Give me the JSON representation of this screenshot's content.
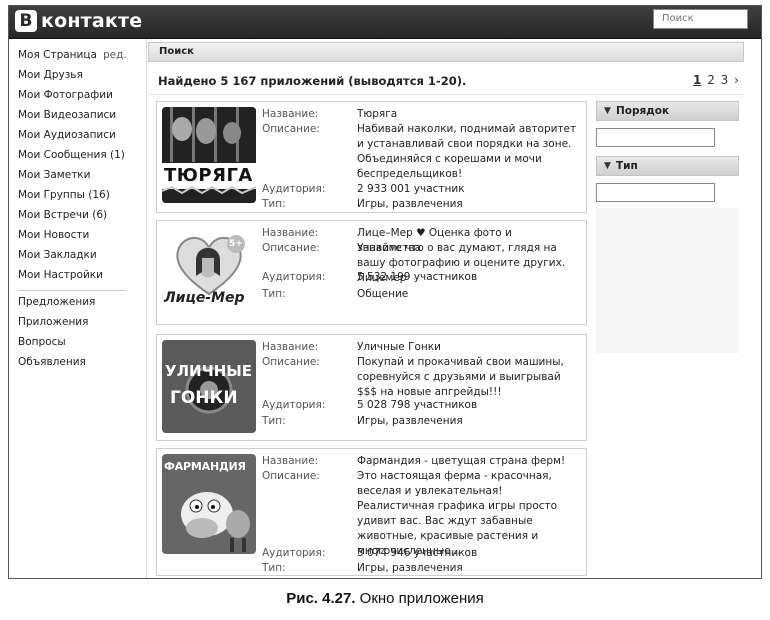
{
  "header": {
    "logo_letter": "В",
    "logo_text": "контакте",
    "search_placeholder": "Поиск"
  },
  "sidebar": {
    "items": [
      {
        "label": "Моя Страница",
        "extra": "ред."
      },
      {
        "label": "Мои Друзья"
      },
      {
        "label": "Мои Фотографии"
      },
      {
        "label": "Мои Видеозаписи"
      },
      {
        "label": "Мои Аудиозаписи"
      },
      {
        "label": "Мои Сообщения (1)"
      },
      {
        "label": "Мои Заметки"
      },
      {
        "label": "Мои Группы (16)"
      },
      {
        "label": "Мои Встречи (6)"
      },
      {
        "label": "Мои Новости"
      },
      {
        "label": "Мои Закладки"
      },
      {
        "label": "Мои Настройки"
      }
    ],
    "extra_items": [
      {
        "label": "Предложения"
      },
      {
        "label": "Приложения"
      },
      {
        "label": "Вопросы"
      },
      {
        "label": "Объявления"
      }
    ]
  },
  "main": {
    "panel_title": "Поиск",
    "found_text": "Найдено 5 167 приложений (выводятся 1-20).",
    "pages": {
      "current": "1",
      "p2": "2",
      "p3": "3",
      "next": "›"
    },
    "labels": {
      "name": "Название:",
      "desc": "Описание:",
      "aud": "Аудитория:",
      "type": "Тип:"
    },
    "apps": [
      {
        "name": "Тюряга",
        "desc": "Набивай наколки, поднимай авторитет и устанавливай свои порядки на зоне. Объединяйся с корешами и мочи беспредельщиков!",
        "aud": "2 933 001 участник",
        "type": "Игры, развлечения",
        "thumb_text": "ТЮРЯГА"
      },
      {
        "name": "Лице–Мер ♥ Оценка фото и знакомства",
        "desc": "Узнайте что о вас думают, глядя на вашу фотографию и оцените других. Лицемер",
        "aud": "5 532 199 участников",
        "type": "Общение",
        "thumb_text": "Лице-Мер",
        "thumb_badge": "5+"
      },
      {
        "name": "Уличные Гонки",
        "desc": "Покупай и прокачивай свои машины, соревнуйся с друзьями и выигрывай $$$ на новые апгрейды!!!",
        "aud": "5 028 798 участников",
        "type": "Игры, развлечения",
        "thumb_text1": "УЛИЧНЫЕ",
        "thumb_text2": "ГОНКИ"
      },
      {
        "name": "Фармандия - цветущая страна ферм!",
        "desc": "Это настоящая ферма - красочная, веселая и увлекательная! Реалистичная графика игры просто удивит вас. Вас ждут забавные животные, красивые растения и многочисленные...",
        "aud": "3 074 946 участников",
        "type": "Игры, развлечения",
        "thumb_text": "ФАРМАНДИЯ"
      }
    ]
  },
  "filters": {
    "order_label": "Порядок",
    "type_label": "Тип"
  },
  "caption": {
    "prefix": "Рис. 4.27.",
    "text": "Окно приложения"
  }
}
